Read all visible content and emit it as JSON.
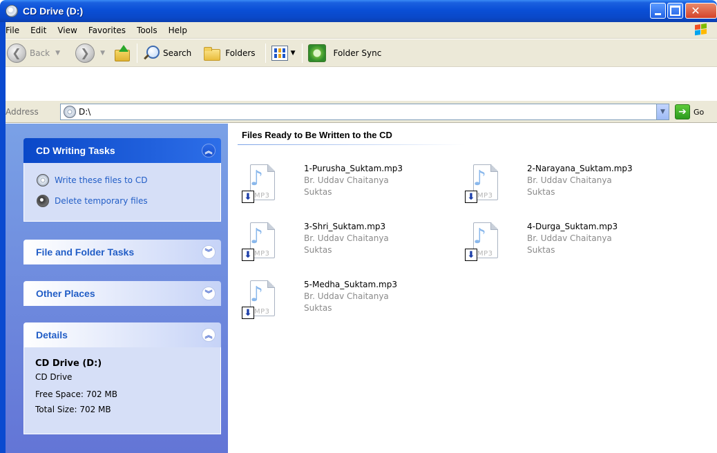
{
  "window": {
    "title": "CD Drive (D:)"
  },
  "menu": [
    "File",
    "Edit",
    "View",
    "Favorites",
    "Tools",
    "Help"
  ],
  "toolbar": {
    "back": "Back",
    "search": "Search",
    "folders": "Folders",
    "folder_sync": "Folder Sync"
  },
  "address": {
    "label": "Address",
    "value": "D:\\",
    "go": "Go"
  },
  "sidebar": {
    "cd_writing": {
      "title": "CD Writing Tasks",
      "tasks": [
        "Write these files to CD",
        "Delete temporary files"
      ]
    },
    "file_folder_tasks": {
      "title": "File and Folder Tasks"
    },
    "other_places": {
      "title": "Other Places"
    },
    "details": {
      "title": "Details",
      "name": "CD Drive (D:)",
      "type": "CD Drive",
      "free_space": "Free Space: 702 MB",
      "total_size": "Total Size: 702 MB"
    }
  },
  "main": {
    "group_title": "Files Ready to Be Written to the CD",
    "files": [
      {
        "name": "1-Purusha_Suktam.mp3",
        "artist": "Br. Uddav Chaitanya",
        "album": "Suktas"
      },
      {
        "name": "2-Narayana_Suktam.mp3",
        "artist": "Br. Uddav Chaitanya",
        "album": "Suktas"
      },
      {
        "name": "3-Shri_Suktam.mp3",
        "artist": "Br. Uddav Chaitanya",
        "album": "Suktas"
      },
      {
        "name": "4-Durga_Suktam.mp3",
        "artist": "Br. Uddav Chaitanya",
        "album": "Suktas"
      },
      {
        "name": "5-Medha_Suktam.mp3",
        "artist": "Br. Uddav Chaitanya",
        "album": "Suktas"
      }
    ],
    "icon_badge": "MP3"
  }
}
